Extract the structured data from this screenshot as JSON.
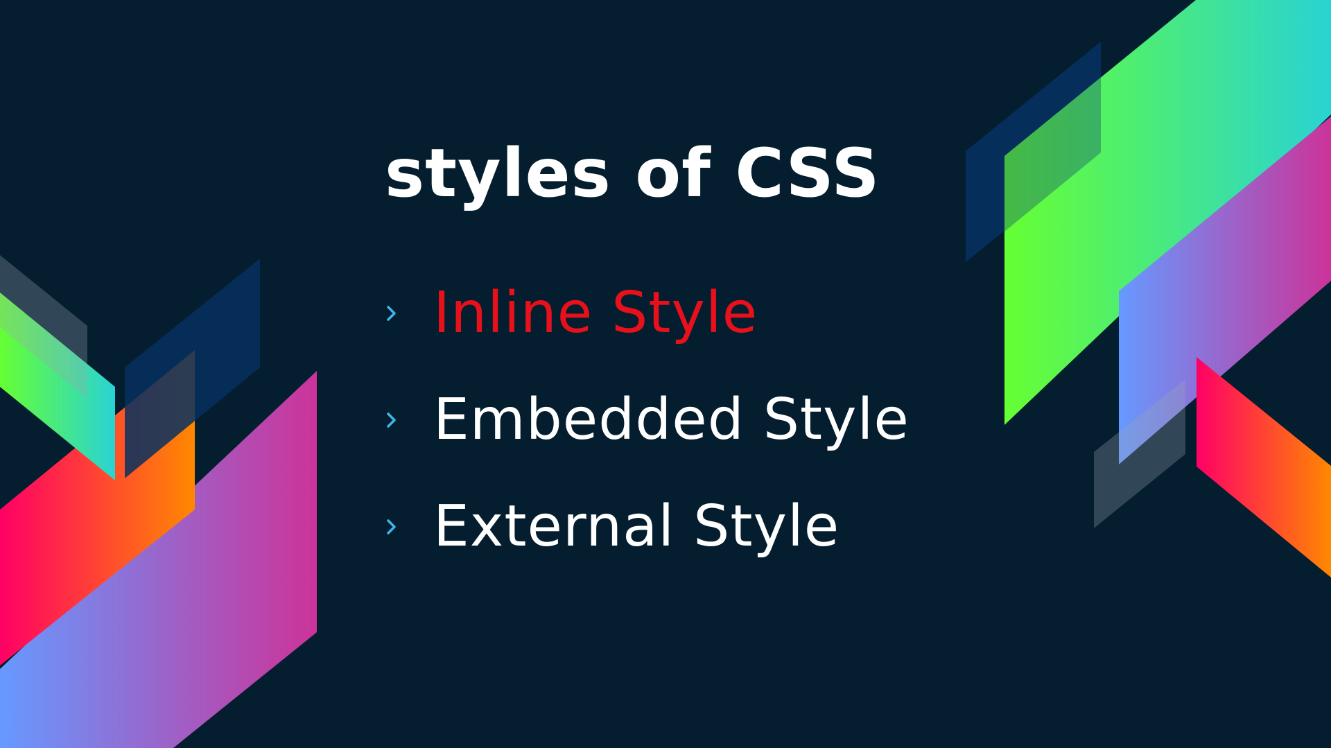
{
  "slide": {
    "title": "styles of CSS",
    "bullets": [
      {
        "label": "Inline Style",
        "highlighted": true
      },
      {
        "label": "Embedded Style",
        "highlighted": false
      },
      {
        "label": "External Style",
        "highlighted": false
      }
    ],
    "bullet_icon": "chevron-right-icon"
  },
  "colors": {
    "background": "#041e2f",
    "title_text": "#ffffff",
    "bullet_text": "#ffffff",
    "highlight_text": "#e8101a",
    "bullet_icon": "#3fb6ea",
    "gradient_green": [
      "#66ff33",
      "#29d3d3"
    ],
    "gradient_magenta": [
      "#6699ff",
      "#cc3399"
    ],
    "gradient_red_orange": [
      "#ff0066",
      "#ff8800"
    ],
    "translucent_navy": "#07305f"
  }
}
